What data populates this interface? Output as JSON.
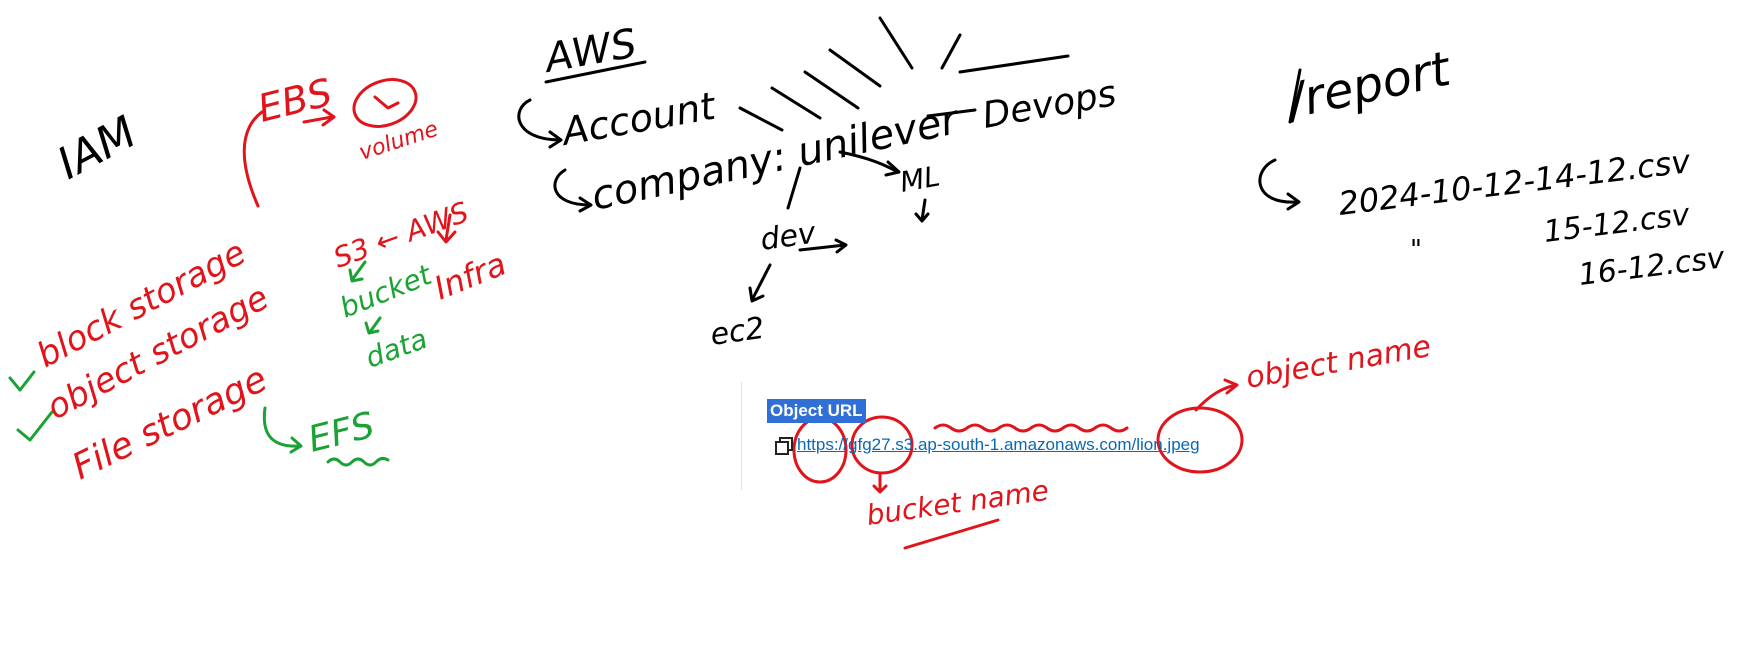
{
  "notes": {
    "iam": "IAM",
    "ebs": "EBS",
    "volume": "volume",
    "block_storage": "block storage",
    "object_storage": "object storage",
    "file_storage": "File storage",
    "s3_aws": "S3 ← AWS",
    "bucket": "bucket",
    "data": "data",
    "infra": "Infra",
    "efs": "EFS",
    "aws": "AWS",
    "account": "Account",
    "company": "company: unilever",
    "devops": "Devops",
    "ml": "ML",
    "dev": "dev",
    "ec2": "ec2",
    "report": "/report",
    "report_file_1": "2024-10-12-14-12.csv",
    "report_ditto": "\"",
    "report_file_2": "15-12.csv",
    "report_file_3": "16-12.csv",
    "object_name": "object name",
    "bucket_name": "bucket name"
  },
  "snippet": {
    "heading": "Object URL",
    "url": "https://gfg27.s3.ap-south-1.amazonaws.com/lion.jpeg"
  },
  "colors": {
    "ink_black": "#000000",
    "ink_red": "#e0141a",
    "ink_green": "#1aa334",
    "highlight": "#2f6fd6",
    "link": "#0a68b8"
  }
}
